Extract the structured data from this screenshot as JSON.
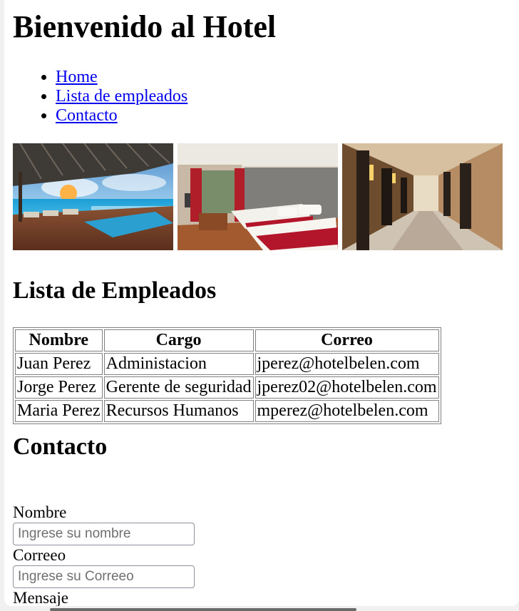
{
  "header": {
    "title": "Bienvenido al Hotel"
  },
  "nav": {
    "items": [
      {
        "label": "Home"
      },
      {
        "label": "Lista de empleados"
      },
      {
        "label": "Contacto"
      }
    ]
  },
  "gallery": {
    "images": [
      {
        "name": "pool-terrace-image"
      },
      {
        "name": "hotel-room-image"
      },
      {
        "name": "hotel-corridor-image"
      }
    ]
  },
  "employees": {
    "heading": "Lista de Empleados",
    "columns": [
      "Nombre",
      "Cargo",
      "Correo"
    ],
    "rows": [
      [
        "Juan Perez",
        "Administacion",
        "jperez@hotelbelen.com"
      ],
      [
        "Jorge Perez",
        "Gerente de seguridad",
        "jperez02@hotelbelen.com"
      ],
      [
        "Maria Perez",
        "Recursos Humanos",
        "mperez@hotelbelen.com"
      ]
    ]
  },
  "contact": {
    "heading": "Contacto",
    "name_label": "Nombre",
    "name_placeholder": "Ingrese su nombre",
    "email_label": "Correeo",
    "email_placeholder": "Ingrese su Correeo",
    "message_label": "Mensaje"
  }
}
